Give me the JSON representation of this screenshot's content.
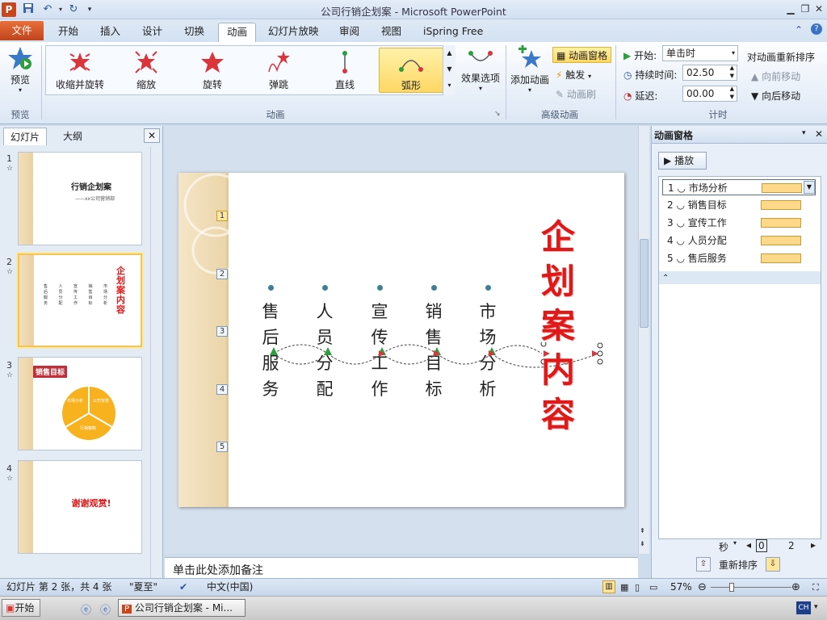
{
  "window": {
    "title": "公司行销企划案 - Microsoft PowerPoint"
  },
  "tabs": {
    "file": "文件",
    "items": [
      "开始",
      "插入",
      "设计",
      "切换",
      "动画",
      "幻灯片放映",
      "审阅",
      "视图",
      "iSpring Free"
    ]
  },
  "ribbon": {
    "preview": {
      "label": "预览",
      "group": "预览"
    },
    "animation_gallery": [
      "收缩并旋转",
      "缩放",
      "旋转",
      "弹跳",
      "直线",
      "弧形"
    ],
    "effect_options": "效果选项",
    "animation_group": "动画",
    "add_animation": "添加动画",
    "animation_pane_btn": "动画窗格",
    "trigger": "触发",
    "animation_painter": "动画刷",
    "advanced_group": "高级动画",
    "start_label": "开始:",
    "start_value": "单击时",
    "duration_label": "持续时间:",
    "duration_value": "02.50",
    "delay_label": "延迟:",
    "delay_value": "00.00",
    "reorder_title": "对动画重新排序",
    "move_earlier": "向前移动",
    "move_later": "向后移动",
    "timing_group": "计时"
  },
  "left_panel": {
    "tab_slides": "幻灯片",
    "tab_outline": "大纲",
    "slides": [
      {
        "num": "1",
        "title": "行销企划案",
        "subtitle": "——xx公司营销部"
      },
      {
        "num": "2",
        "title": "企划案内容"
      },
      {
        "num": "3",
        "title": "销售目标",
        "c1": "市场分析",
        "c2": "公司背景",
        "c3": "行销策略"
      },
      {
        "num": "4",
        "title": "谢谢观赏!"
      }
    ]
  },
  "slide": {
    "title": "企划案内容",
    "columns": [
      {
        "text": "售后服务"
      },
      {
        "text": "人员分配"
      },
      {
        "text": "宣传工作"
      },
      {
        "text": "销售目标"
      },
      {
        "text": "市场分析"
      }
    ],
    "markers": [
      "1",
      "2",
      "3",
      "4",
      "5"
    ]
  },
  "notes": {
    "placeholder": "单击此处添加备注"
  },
  "animation_pane": {
    "title": "动画窗格",
    "play": "播放",
    "items": [
      {
        "num": "1",
        "label": "市场分析"
      },
      {
        "num": "2",
        "label": "销售目标"
      },
      {
        "num": "3",
        "label": "宣传工作"
      },
      {
        "num": "4",
        "label": "人员分配"
      },
      {
        "num": "5",
        "label": "售后服务"
      }
    ],
    "seconds": "秒",
    "timeline_0": "0",
    "timeline_2": "2",
    "reorder": "重新排序"
  },
  "status": {
    "slide_info": "幻灯片 第 2 张，共 4 张",
    "theme": "\"夏至\"",
    "language": "中文(中国)",
    "zoom": "57%"
  },
  "taskbar": {
    "start": "开始",
    "task": "公司行销企划案 - Mi...",
    "ime": "CH"
  }
}
